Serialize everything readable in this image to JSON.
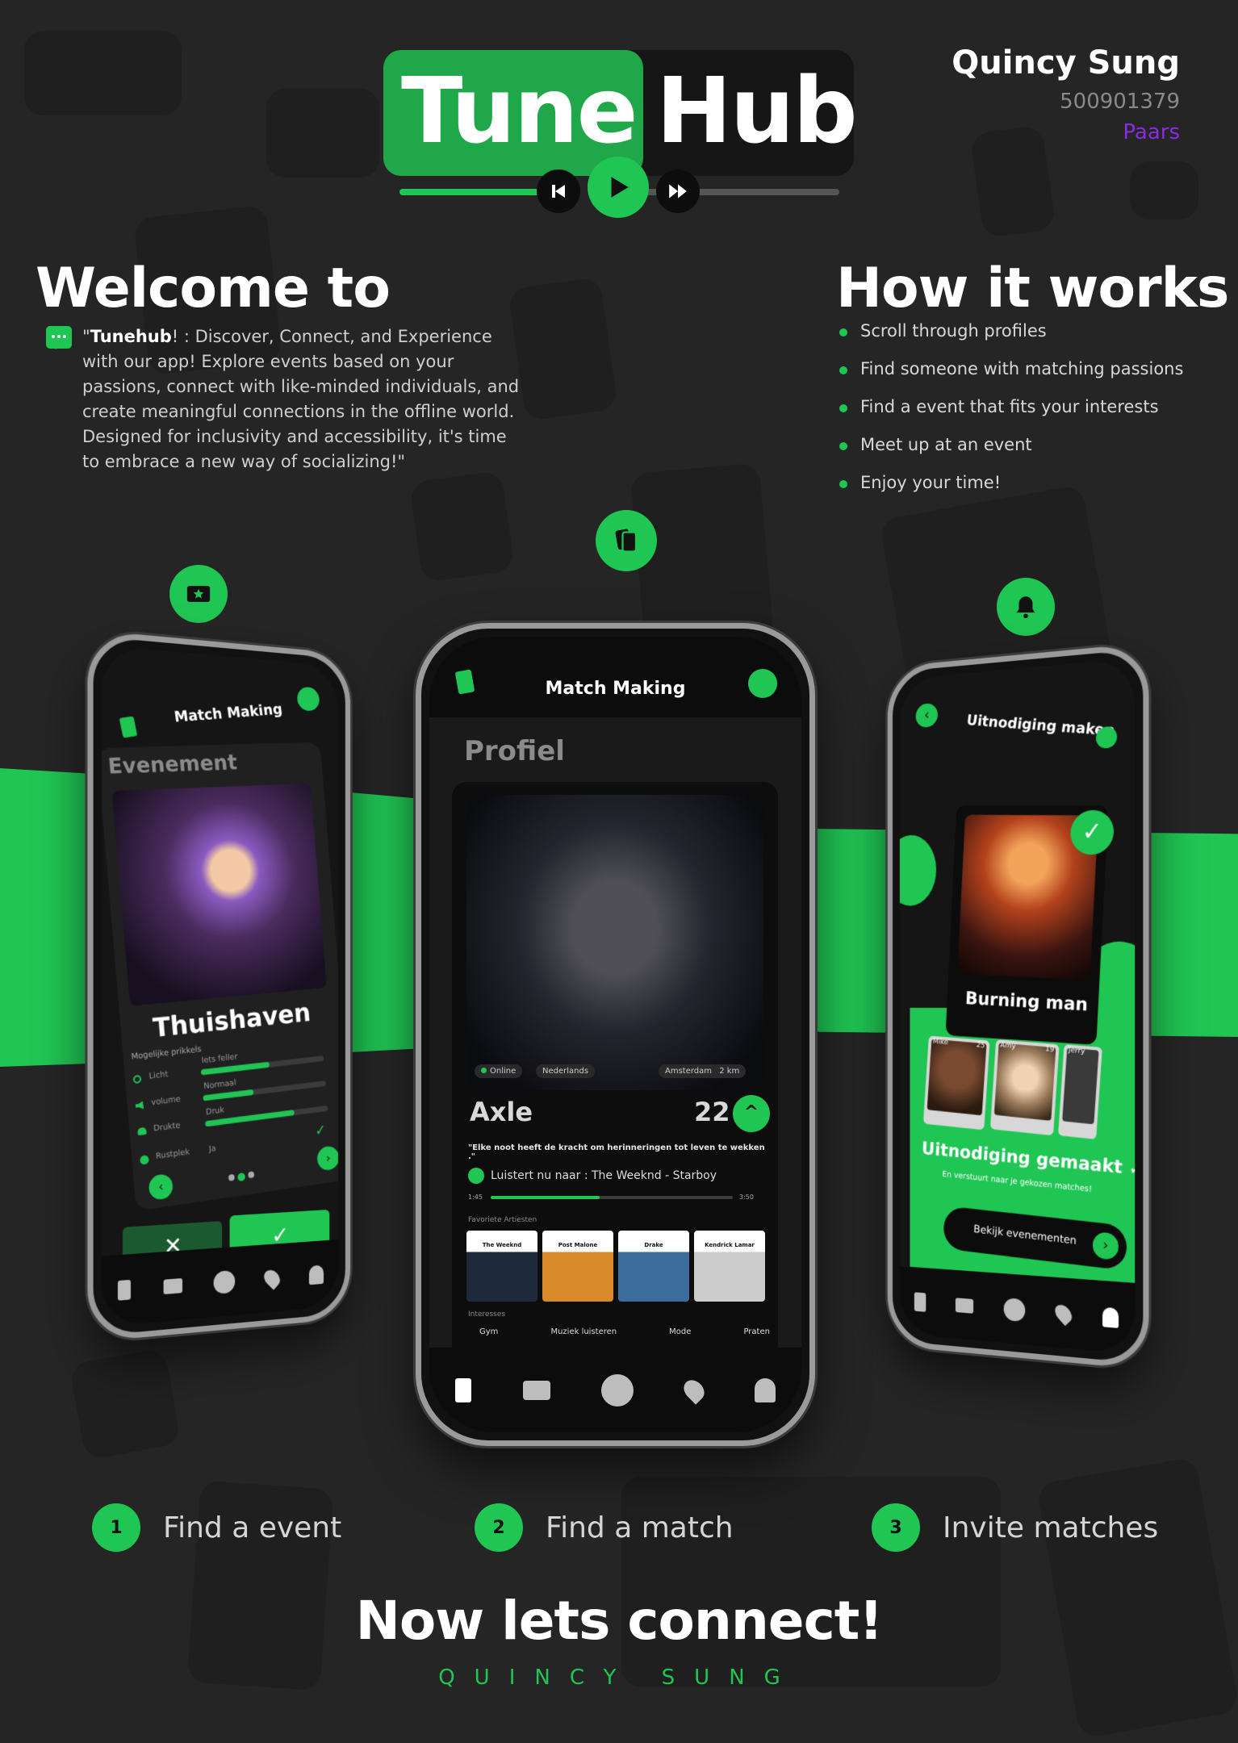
{
  "logo": {
    "word1": "Tune",
    "word2": "Hub"
  },
  "author": {
    "name": "Quincy Sung",
    "student_id": "500901379",
    "class": "Paars"
  },
  "welcome": {
    "title": "Welcome to",
    "quote_prefix": "\"",
    "brand": "Tunehub",
    "quote_body": "! : Discover, Connect, and Experience with our app! Explore events based on your passions, connect with like-minded individuals, and create meaningful connections in the offline world. Designed for inclusivity and accessibility, it's time to embrace a new way of socializing!\""
  },
  "how": {
    "title": "How it works",
    "items": [
      "Scroll through profiles",
      "Find someone with matching passions",
      "Find a event that fits your interests",
      "Meet up at an event",
      "Enjoy your time!"
    ]
  },
  "phone_left": {
    "header": "Match Making",
    "section": "Evenement",
    "venue": "Thuishaven",
    "stimuli_title": "Mogelijke prikkels",
    "rows": [
      {
        "label": "Licht",
        "value": "Iets feller",
        "level": 0.55
      },
      {
        "label": "volume",
        "value": "Normaal",
        "level": 0.4
      },
      {
        "label": "Drukte",
        "value": "Druk",
        "level": 0.72
      },
      {
        "label": "Rustplek",
        "value": "Ja",
        "level": 0
      }
    ]
  },
  "phone_center": {
    "header": "Match Making",
    "section": "Profiel",
    "tags": [
      "Online",
      "Nederlands",
      "Amsterdam",
      "2 km"
    ],
    "name": "Axle",
    "age": "22",
    "quote": "\"Elke noot heeft de kracht om herinneringen tot leven te wekken .\"",
    "now_playing": "Luistert nu naar : The Weeknd - Starboy",
    "time_start": "1:45",
    "time_end": "3:50",
    "progress": 0.45,
    "fav_title": "Favoriete Artiesten",
    "artists": [
      "The Weeknd",
      "Post Malone",
      "Drake",
      "Kendrick Lamar"
    ],
    "interests_title": "Interesses",
    "interests": [
      "Gym",
      "Muziek luisteren",
      "Mode",
      "Praten"
    ]
  },
  "phone_right": {
    "header": "Uitnodiging maken",
    "event": "Burning man",
    "people": [
      {
        "name": "Mike",
        "age": "25"
      },
      {
        "name": "Amy",
        "age": "19"
      },
      {
        "name": "Jerry",
        "age": ""
      }
    ],
    "done": "Uitnodiging gemaakt",
    "sub": "En verstuurt naar je gekozen matches!",
    "cta": "Bekijk evenementen"
  },
  "steps": [
    {
      "n": "1",
      "label": "Find a event"
    },
    {
      "n": "2",
      "label": "Find a match"
    },
    {
      "n": "3",
      "label": "Invite matches"
    }
  ],
  "footer": {
    "title": "Now lets connect!",
    "sub": "QUINCY SUNG"
  },
  "colors": {
    "accent": "#1fc653",
    "bg": "#252525",
    "class": "#8a2be2"
  }
}
